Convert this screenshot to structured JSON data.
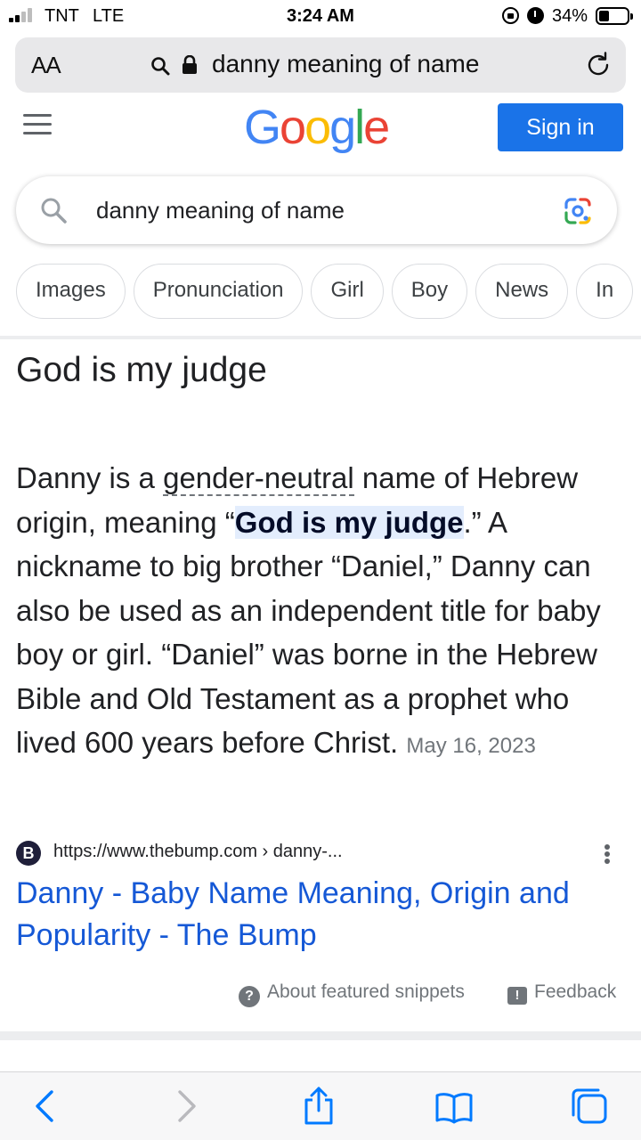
{
  "status_bar": {
    "carrier": "TNT",
    "network": "LTE",
    "time": "3:24 AM",
    "battery_percent": "34%",
    "battery_level": 0.34
  },
  "address_bar": {
    "text_size_label": "AA",
    "url_text": "danny meaning of name"
  },
  "google": {
    "logo_letters": [
      {
        "char": "G",
        "color": "#4285f4"
      },
      {
        "char": "o",
        "color": "#ea4335"
      },
      {
        "char": "o",
        "color": "#fbbc05"
      },
      {
        "char": "g",
        "color": "#4285f4"
      },
      {
        "char": "l",
        "color": "#34a853"
      },
      {
        "char": "e",
        "color": "#ea4335"
      }
    ],
    "sign_in_label": "Sign in"
  },
  "search": {
    "query": "danny meaning of name"
  },
  "chips": [
    "Images",
    "Pronunciation",
    "Girl",
    "Boy",
    "News",
    "In"
  ],
  "featured_snippet": {
    "answer": "God is my judge",
    "text_parts": {
      "p1": "Danny is a ",
      "p2_link": "gender-neutral",
      "p3": " name of Hebrew origin, meaning “",
      "p4_highlight": "God is my judge",
      "p5": ".” A nickname to big brother “Daniel,” Danny can also be used as an independent title for baby boy or girl. “Daniel” was borne in the Hebrew Bible and Old Testament as a prophet who lived 600 years before Christ. ",
      "date": "May 16, 2023"
    },
    "source_icon_letter": "B",
    "source_url": "https://www.thebump.com › danny-...",
    "result_title": "Danny - Baby Name Meaning, Origin and Popularity - The Bump",
    "about_label": "About featured snippets",
    "feedback_label": "Feedback"
  },
  "colors": {
    "accent": "#1a73e8",
    "link": "#1558d6",
    "highlight": "#e3edfd",
    "ios_blue": "#007aff"
  },
  "toolbar_icons": [
    "back-icon",
    "forward-icon",
    "share-icon",
    "bookmarks-icon",
    "tabs-icon"
  ]
}
